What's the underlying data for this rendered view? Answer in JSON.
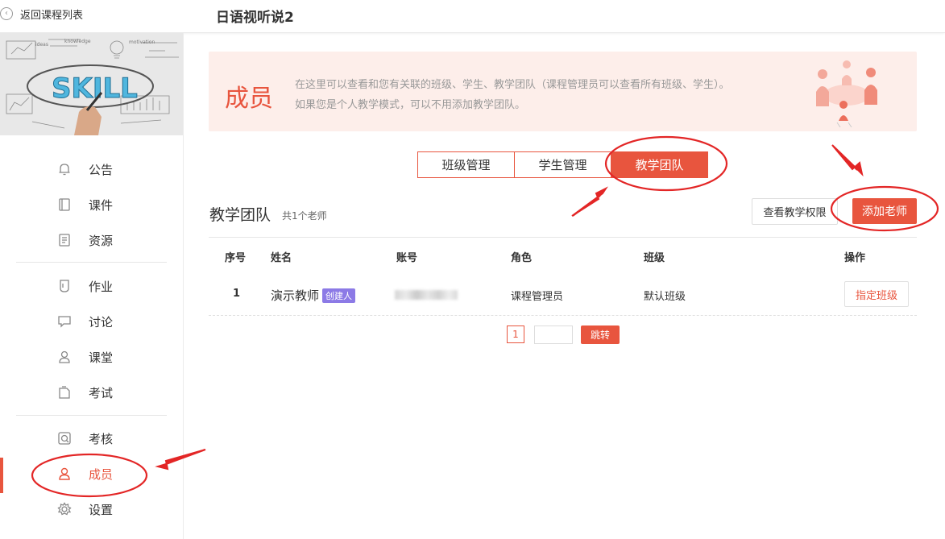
{
  "header": {
    "back_label": "返回课程列表",
    "course_title": "日语视听说2"
  },
  "cover": {
    "skill_text": "SKILL",
    "doodle_words": [
      "ideas",
      "motivation",
      "knowledge"
    ]
  },
  "sidebar": {
    "items": [
      {
        "label": "公告",
        "icon": "bell-icon"
      },
      {
        "label": "课件",
        "icon": "book-icon"
      },
      {
        "label": "资源",
        "icon": "folder-icon"
      },
      {
        "label": "作业",
        "icon": "homework-icon"
      },
      {
        "label": "讨论",
        "icon": "chat-icon"
      },
      {
        "label": "课堂",
        "icon": "classroom-icon"
      },
      {
        "label": "考试",
        "icon": "exam-icon"
      },
      {
        "label": "考核",
        "icon": "assessment-icon"
      },
      {
        "label": "成员",
        "icon": "person-icon",
        "active": true
      },
      {
        "label": "设置",
        "icon": "gear-icon"
      }
    ]
  },
  "banner": {
    "title": "成员",
    "desc_line1": "在这里可以查看和您有关联的班级、学生、教学团队（课程管理员可以查看所有班级、学生）。",
    "desc_line2": "如果您是个人教学模式，可以不用添加教学团队。"
  },
  "tabs": [
    {
      "label": "班级管理",
      "active": false
    },
    {
      "label": "学生管理",
      "active": false
    },
    {
      "label": "教学团队",
      "active": true
    }
  ],
  "team": {
    "title": "教学团队",
    "count": "共1个老师",
    "perm_button": "查看教学权限",
    "add_button": "添加老师"
  },
  "table": {
    "headers": [
      "序号",
      "姓名",
      "账号",
      "角色",
      "班级",
      "操作"
    ],
    "rows": [
      {
        "index": "1",
        "name": "演示教师",
        "badge": "创建人",
        "role": "课程管理员",
        "class": "默认班级",
        "action": "指定班级"
      }
    ]
  },
  "pagination": {
    "current": "1",
    "input_value": "",
    "jump_label": "跳转"
  },
  "colors": {
    "accent": "#e8553e",
    "banner_bg": "#fdeeea",
    "badge": "#8c7ae6"
  }
}
